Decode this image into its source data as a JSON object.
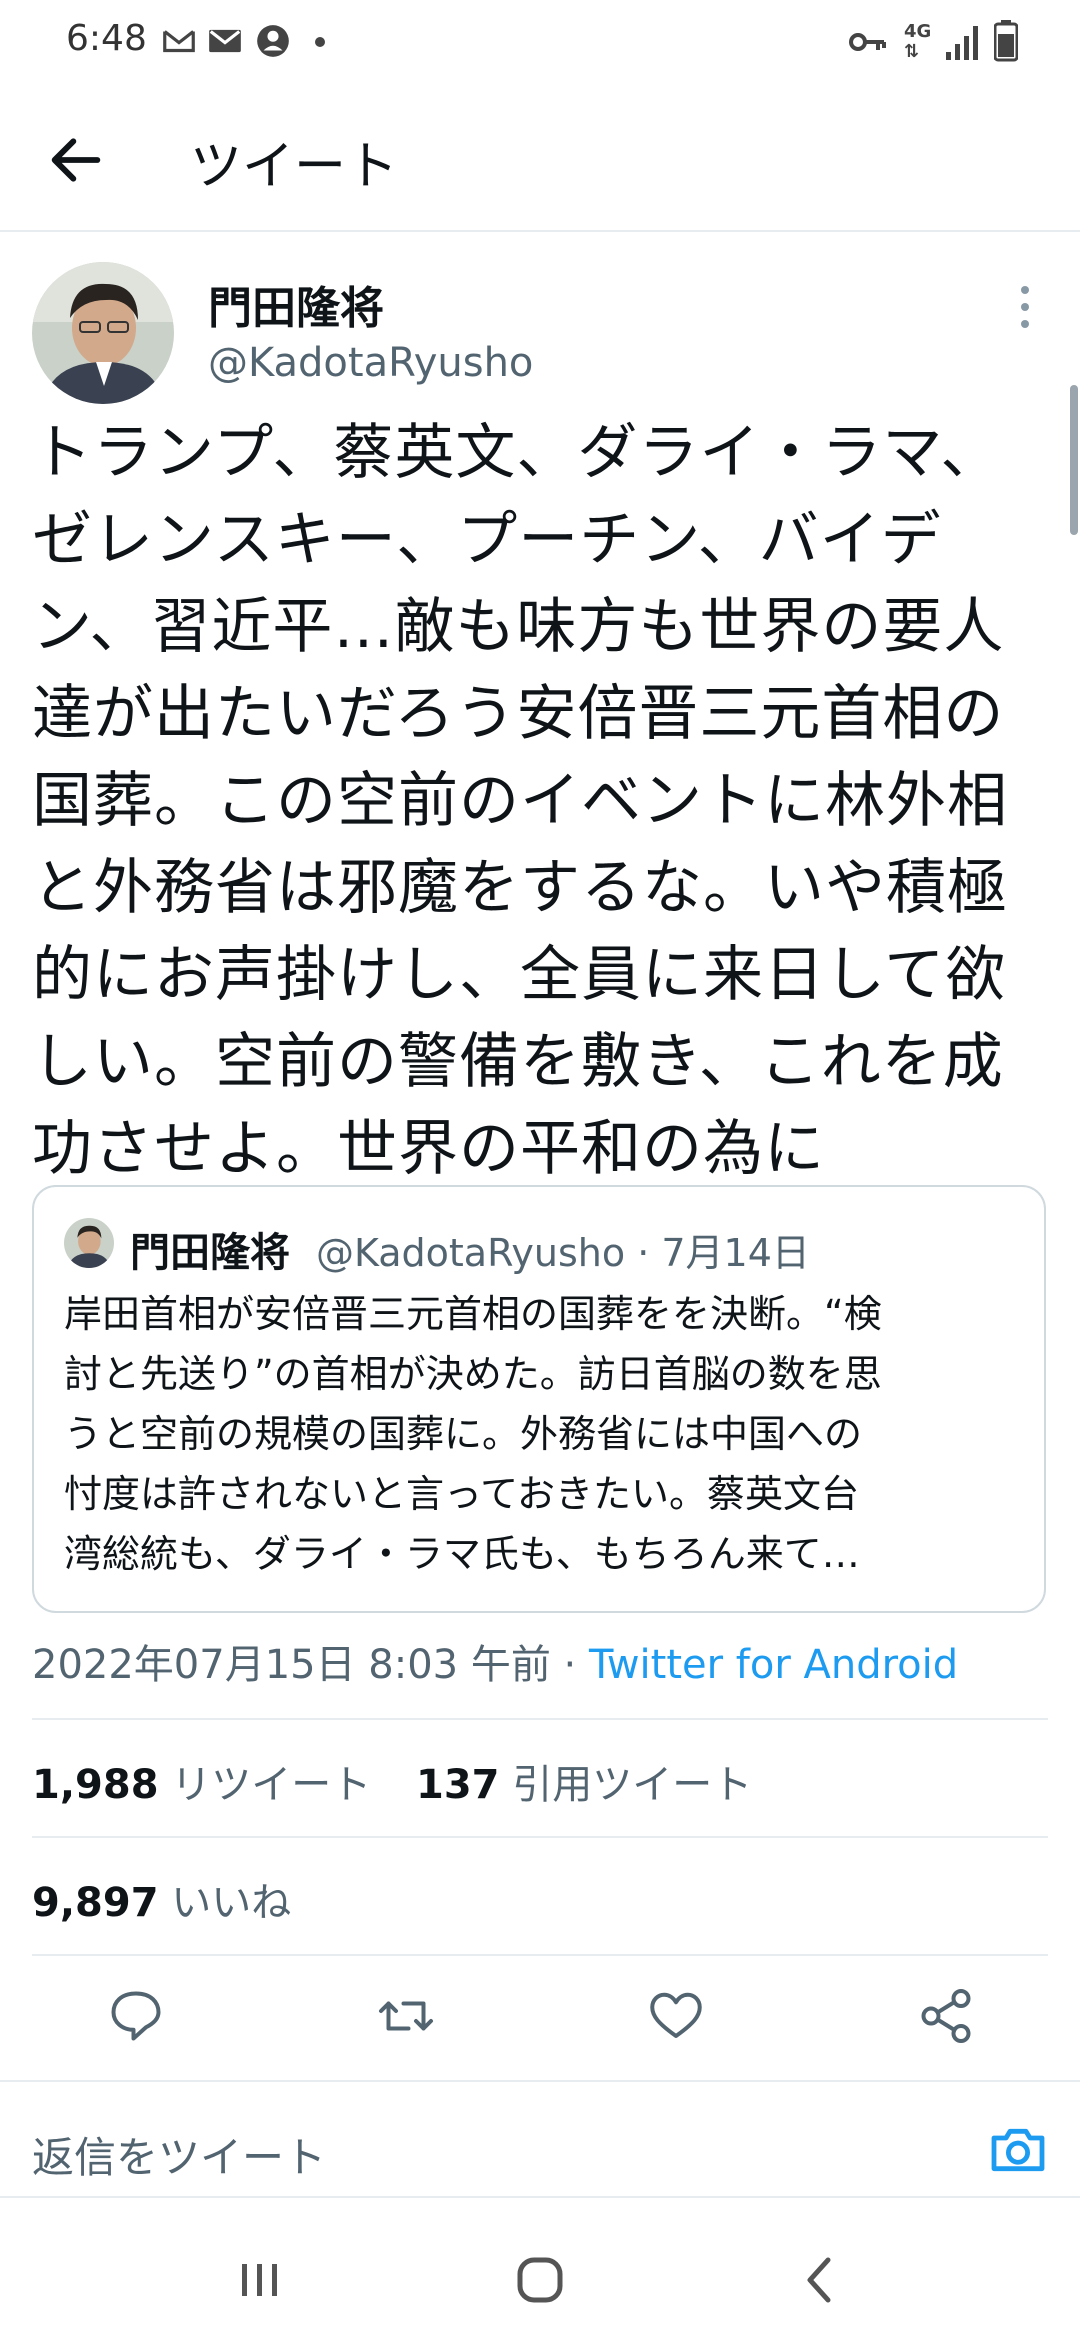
{
  "status_bar": {
    "time": "6:48",
    "left_icons": [
      "gmail-icon",
      "mail-icon",
      "account-icon",
      "dot-icon"
    ],
    "right_icons": [
      "vpn-key-icon",
      "4g-icon",
      "signal-icon",
      "battery-icon"
    ],
    "network_label": "4G"
  },
  "header": {
    "title": "ツイート"
  },
  "tweet": {
    "display_name": "門田隆将",
    "handle": "@KadotaRyusho",
    "text": "トランプ、蔡英文、ダライ・ラマ、\nゼレンスキー、プーチン、バイデ\nン、習近平…敵も味方も世界の要人\n達が出たいだろう安倍晋三元首相の\n国葬。この空前のイベントに林外相\nと外務省は邪魔をするな。いや積極\n的にお声掛けし、全員に来日して欲\nしい。空前の警備を敷き、これを成\n功させよ。世界の平和の為に",
    "timestamp": "2022年07月15日 8:03 午前 · ",
    "source": "Twitter for Android"
  },
  "quote": {
    "display_name": "門田隆将",
    "meta": "@KadotaRyusho · 7月14日",
    "text": "岸田首相が安倍晋三元首相の国葬をを決断。“検\n討と先送り”の首相が決めた。訪日首脳の数を思\nうと空前の規模の国葬に。外務省には中国への\n忖度は許されないと言っておきたい。蔡英文台\n湾総統も、ダライ・ラマ氏も、もちろん来て…"
  },
  "stats": {
    "retweets_count": "1,988",
    "retweets_label": "リツイート",
    "quotes_count": "137",
    "quotes_label": "引用ツイート",
    "likes_count": "9,897",
    "likes_label": "いいね"
  },
  "actions": [
    "reply-icon",
    "retweet-icon",
    "like-icon",
    "share-icon"
  ],
  "reply_bar": {
    "placeholder": "返信をツイート"
  },
  "nav_bar": [
    "recents-icon",
    "home-icon",
    "back-icon"
  ],
  "colors": {
    "accent": "#1d9bf0",
    "secondary_text": "#536471",
    "divider": "#e6ecf0"
  }
}
